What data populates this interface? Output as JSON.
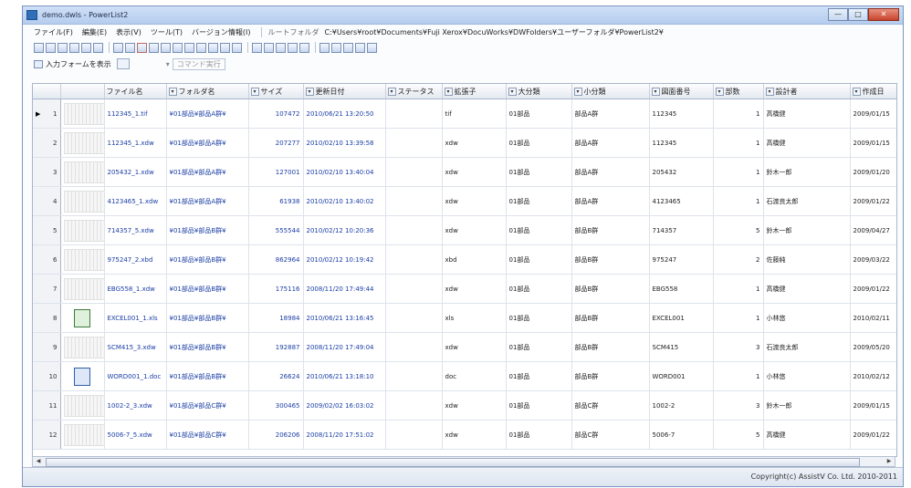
{
  "window": {
    "title": "demo.dwls - PowerList2"
  },
  "titlebar": {
    "min": "—",
    "max": "□",
    "close": "✕"
  },
  "menu": {
    "items": [
      "ファイル(F)",
      "編集(E)",
      "表示(V)",
      "ツール(T)",
      "バージョン情報(I)"
    ],
    "root_label": "ルートフォルダ",
    "root_path": "C:¥Users¥root¥Documents¥Fuji Xerox¥DocuWorks¥DWFolders¥ユーザーフォルダ¥PowerList2¥"
  },
  "toolbar2": {
    "form_button": "入力フォームを表示",
    "command_label": "コマンド実行"
  },
  "table": {
    "headers": [
      "ファイル名",
      "フォルダ名",
      "サイズ",
      "更新日付",
      "ステータス",
      "拡張子",
      "大分類",
      "小分類",
      "図面番号",
      "部数",
      "設計者",
      "作成日"
    ],
    "rows": [
      {
        "no": "1",
        "file": "112345_1.tif",
        "folder": "¥01部品¥部品A群¥",
        "size": "107472",
        "updated": "2010/06/21 13:20:50",
        "status": "",
        "ext": "tif",
        "major": "01部品",
        "minor": "部品A群",
        "drawing": "112345",
        "copies": "1",
        "designer": "高橋健",
        "created": "2009/01/15",
        "thumb": "scan",
        "selected": true
      },
      {
        "no": "2",
        "file": "112345_1.xdw",
        "folder": "¥01部品¥部品A群¥",
        "size": "207277",
        "updated": "2010/02/10 13:39:58",
        "status": "",
        "ext": "xdw",
        "major": "01部品",
        "minor": "部品A群",
        "drawing": "112345",
        "copies": "1",
        "designer": "高橋健",
        "created": "2009/01/15",
        "thumb": "scan"
      },
      {
        "no": "3",
        "file": "205432_1.xdw",
        "folder": "¥01部品¥部品A群¥",
        "size": "127001",
        "updated": "2010/02/10 13:40:04",
        "status": "",
        "ext": "xdw",
        "major": "01部品",
        "minor": "部品A群",
        "drawing": "205432",
        "copies": "1",
        "designer": "鈴木一郎",
        "created": "2009/01/20",
        "thumb": "scan"
      },
      {
        "no": "4",
        "file": "4123465_1.xdw",
        "folder": "¥01部品¥部品A群¥",
        "size": "61938",
        "updated": "2010/02/10 13:40:02",
        "status": "",
        "ext": "xdw",
        "major": "01部品",
        "minor": "部品A群",
        "drawing": "4123465",
        "copies": "1",
        "designer": "石渡良太郎",
        "created": "2009/01/22",
        "thumb": "scan"
      },
      {
        "no": "5",
        "file": "714357_5.xdw",
        "folder": "¥01部品¥部品B群¥",
        "size": "555544",
        "updated": "2010/02/12 10:20:36",
        "status": "",
        "ext": "xdw",
        "major": "01部品",
        "minor": "部品B群",
        "drawing": "714357",
        "copies": "5",
        "designer": "鈴木一郎",
        "created": "2009/04/27",
        "thumb": "scan"
      },
      {
        "no": "6",
        "file": "975247_2.xbd",
        "folder": "¥01部品¥部品B群¥",
        "size": "862964",
        "updated": "2010/02/12 10:19:42",
        "status": "",
        "ext": "xbd",
        "major": "01部品",
        "minor": "部品B群",
        "drawing": "975247",
        "copies": "2",
        "designer": "佐藤純",
        "created": "2009/03/22",
        "thumb": "scan"
      },
      {
        "no": "7",
        "file": "EBG558_1.xdw",
        "folder": "¥01部品¥部品B群¥",
        "size": "175116",
        "updated": "2008/11/20 17:49:44",
        "status": "",
        "ext": "xdw",
        "major": "01部品",
        "minor": "部品B群",
        "drawing": "EBG558",
        "copies": "1",
        "designer": "高橋健",
        "created": "2009/01/22",
        "thumb": "scan"
      },
      {
        "no": "8",
        "file": "EXCEL001_1.xls",
        "folder": "¥01部品¥部品B群¥",
        "size": "18984",
        "updated": "2010/06/21 13:16:45",
        "status": "",
        "ext": "xls",
        "major": "01部品",
        "minor": "部品B群",
        "drawing": "EXCEL001",
        "copies": "1",
        "designer": "小林悠",
        "created": "2010/02/11",
        "thumb": "xls"
      },
      {
        "no": "9",
        "file": "SCM415_3.xdw",
        "folder": "¥01部品¥部品B群¥",
        "size": "192887",
        "updated": "2008/11/20 17:49:04",
        "status": "",
        "ext": "xdw",
        "major": "01部品",
        "minor": "部品B群",
        "drawing": "SCM415",
        "copies": "3",
        "designer": "石渡良太郎",
        "created": "2009/05/20",
        "thumb": "scan"
      },
      {
        "no": "10",
        "file": "WORD001_1.doc",
        "folder": "¥01部品¥部品B群¥",
        "size": "26624",
        "updated": "2010/06/21 13:18:10",
        "status": "",
        "ext": "doc",
        "major": "01部品",
        "minor": "部品B群",
        "drawing": "WORD001",
        "copies": "1",
        "designer": "小林悠",
        "created": "2010/02/12",
        "thumb": "doc"
      },
      {
        "no": "11",
        "file": "1002-2_3.xdw",
        "folder": "¥01部品¥部品C群¥",
        "size": "300465",
        "updated": "2009/02/02 16:03:02",
        "status": "",
        "ext": "xdw",
        "major": "01部品",
        "minor": "部品C群",
        "drawing": "1002-2",
        "copies": "3",
        "designer": "鈴木一郎",
        "created": "2009/01/15",
        "thumb": "scan"
      },
      {
        "no": "12",
        "file": "5006-7_5.xdw",
        "folder": "¥01部品¥部品C群¥",
        "size": "206206",
        "updated": "2008/11/20 17:51:02",
        "status": "",
        "ext": "xdw",
        "major": "01部品",
        "minor": "部品C群",
        "drawing": "5006-7",
        "copies": "5",
        "designer": "高橋健",
        "created": "2009/01/22",
        "thumb": "scan"
      }
    ]
  },
  "hscroll": {
    "center_mark": "III"
  },
  "status": {
    "copyright": "Copyright(c) AssistV Co. Ltd. 2010-2011"
  }
}
